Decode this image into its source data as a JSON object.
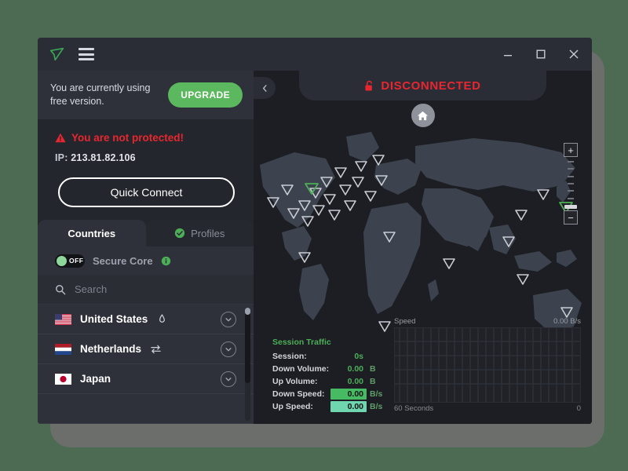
{
  "app": {
    "logo": "paper-plane-logo",
    "menu_icon": "hamburger-menu-icon",
    "window_controls": {
      "minimize": "–",
      "maximize": "☐",
      "close": "✕"
    }
  },
  "sidebar": {
    "upgrade": {
      "message": "You are currently using free version.",
      "button_label": "UPGRADE",
      "button_color": "#5cb85f"
    },
    "status": {
      "warning_icon": "warning-triangle-icon",
      "warning_text": "You are not protected!",
      "warning_color": "#e8262f",
      "ip_label": "IP:",
      "ip_value": "213.81.82.106"
    },
    "quick_connect_label": "Quick Connect",
    "tabs": [
      {
        "label": "Countries",
        "icon": null,
        "active": true
      },
      {
        "label": "Profiles",
        "icon": "check-circle-icon",
        "active": false
      }
    ],
    "secure_core": {
      "toggle_state": "OFF",
      "label": "Secure Core",
      "info_icon": "info-icon"
    },
    "search": {
      "icon": "search-icon",
      "placeholder": "Search",
      "value": ""
    },
    "countries": [
      {
        "name": "United States",
        "flag": "flag-us",
        "feature_icon": "tor-onion-icon",
        "expand_icon": "chevron-down-icon"
      },
      {
        "name": "Netherlands",
        "flag": "flag-nl",
        "feature_icon": "p2p-arrows-icon",
        "expand_icon": "chevron-down-icon"
      },
      {
        "name": "Japan",
        "flag": "flag-jp",
        "feature_icon": null,
        "expand_icon": "chevron-down-icon"
      }
    ]
  },
  "map": {
    "back_icon": "chevron-left-icon",
    "lock_icon": "unlocked-padlock-icon",
    "status_text": "DISCONNECTED",
    "status_color": "#e8262f",
    "home_icon": "home-icon",
    "zoom": {
      "in_label": "+",
      "out_label": "−"
    },
    "marker_icon": "server-marker-triangle"
  },
  "traffic": {
    "title": "Session Traffic",
    "rows": [
      {
        "label": "Session:",
        "value": "0s",
        "unit": "",
        "highlight": null
      },
      {
        "label": "Down Volume:",
        "value": "0.00",
        "unit": "B",
        "highlight": null
      },
      {
        "label": "Up Volume:",
        "value": "0.00",
        "unit": "B",
        "highlight": null
      },
      {
        "label": "Down Speed:",
        "value": "0.00",
        "unit": "B/s",
        "highlight": "#46bb63"
      },
      {
        "label": "Up Speed:",
        "value": "0.00",
        "unit": "B/s",
        "highlight": "#6fd6b0"
      }
    ]
  },
  "chart_data": {
    "type": "line",
    "title": "Speed",
    "xlabel": "60 Seconds",
    "ylabel": "",
    "value_label": "0.00",
    "value_unit": "B/s",
    "x_left_tick": "60 Seconds",
    "x_right_tick": "0",
    "grid": true,
    "x": [
      60,
      55,
      50,
      45,
      40,
      35,
      30,
      25,
      20,
      15,
      10,
      5,
      0
    ],
    "series": [
      {
        "name": "Down Speed",
        "values": [
          0,
          0,
          0,
          0,
          0,
          0,
          0,
          0,
          0,
          0,
          0,
          0,
          0
        ]
      },
      {
        "name": "Up Speed",
        "values": [
          0,
          0,
          0,
          0,
          0,
          0,
          0,
          0,
          0,
          0,
          0,
          0,
          0
        ]
      }
    ],
    "ylim": [
      0,
      0
    ],
    "xlim": [
      60,
      0
    ]
  }
}
